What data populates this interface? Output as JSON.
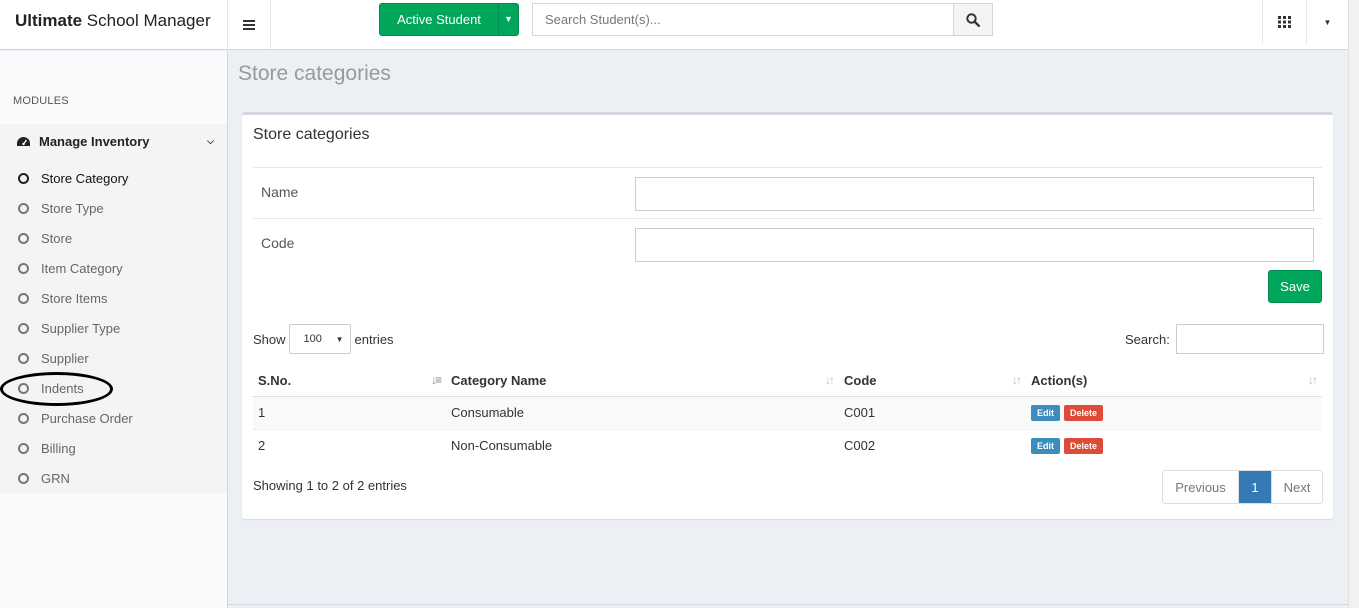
{
  "brand": {
    "bold": "Ultimate",
    "rest": " School Manager"
  },
  "header": {
    "active_student_label": "Active Student",
    "search_placeholder": "Search Student(s)..."
  },
  "sidebar": {
    "section": "MODULES",
    "group_label": "Manage Inventory",
    "items": [
      {
        "label": "Store Category",
        "active": true
      },
      {
        "label": "Store Type"
      },
      {
        "label": "Store"
      },
      {
        "label": "Item Category"
      },
      {
        "label": "Store Items"
      },
      {
        "label": "Supplier Type"
      },
      {
        "label": "Supplier"
      },
      {
        "label": "Indents",
        "circled": true
      },
      {
        "label": "Purchase Order"
      },
      {
        "label": "Billing"
      },
      {
        "label": "GRN"
      }
    ]
  },
  "page": {
    "title": "Store categories"
  },
  "form": {
    "box_title": "Store categories",
    "name_label": "Name",
    "code_label": "Code",
    "save_label": "Save"
  },
  "table_controls": {
    "show_label": "Show",
    "entries_value": "100",
    "entries_label": "entries",
    "search_label": "Search:"
  },
  "table": {
    "headers": [
      "S.No.",
      "Category Name",
      "Code",
      "Action(s)"
    ],
    "rows": [
      {
        "sno": "1",
        "name": "Consumable",
        "code": "C001"
      },
      {
        "sno": "2",
        "name": "Non-Consumable",
        "code": "C002"
      }
    ],
    "edit_label": "Edit",
    "delete_label": "Delete"
  },
  "pagination": {
    "info": "Showing 1 to 2 of 2 entries",
    "previous": "Previous",
    "current": "1",
    "next": "Next"
  },
  "colors": {
    "success": "#00a65a",
    "primary": "#3c8dbc",
    "danger": "#dd4b39",
    "page_bg": "#ecf0f5"
  }
}
